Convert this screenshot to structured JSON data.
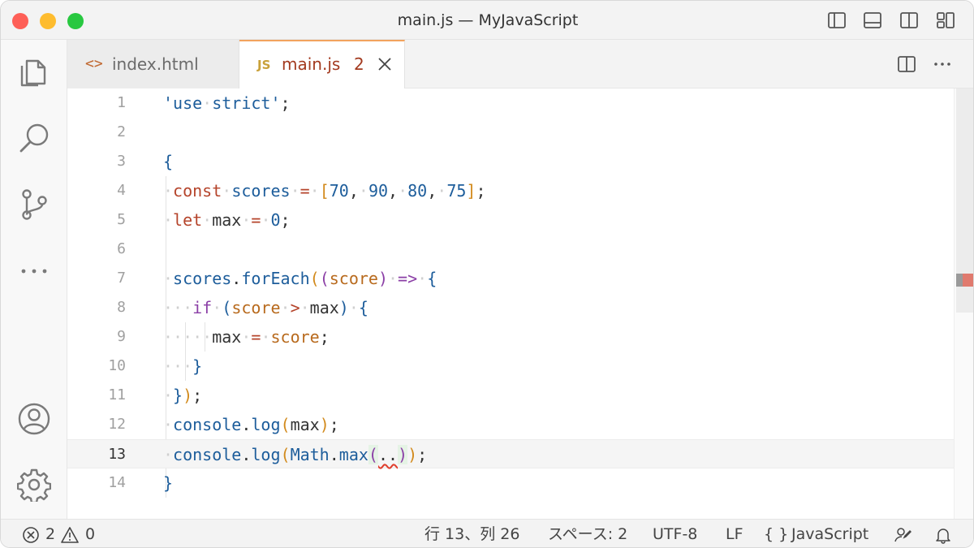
{
  "window": {
    "title": "main.js — MyJavaScript"
  },
  "tabs": [
    {
      "icon": "<>",
      "label": "index.html"
    },
    {
      "icon": "JS",
      "label": "main.js",
      "badge": "2"
    }
  ],
  "editor": {
    "line_numbers": [
      "1",
      "2",
      "3",
      "4",
      "5",
      "6",
      "7",
      "8",
      "9",
      "10",
      "11",
      "12",
      "13",
      "14"
    ],
    "current_line": 13
  },
  "status": {
    "errors": "2",
    "warnings": "0",
    "cursor": "行 13、列 26",
    "indent": "スペース: 2",
    "encoding": "UTF-8",
    "eol": "LF",
    "language_braces": "{ }",
    "language": "JavaScript"
  },
  "colors": {
    "keyword": "#b5442b",
    "identifier": "#1d5d9b",
    "bracket": "#d28a1c",
    "tab_accent": "#f2a35e"
  },
  "icons": {
    "activity": [
      "explorer-icon",
      "search-icon",
      "source-control-icon",
      "more-icon",
      "account-icon",
      "settings-gear-icon"
    ],
    "titlebar": [
      "toggle-primary-sidebar-icon",
      "toggle-panel-icon",
      "toggle-secondary-sidebar-icon",
      "customize-layout-icon"
    ],
    "editor_actions": [
      "split-editor-icon",
      "more-actions-icon"
    ],
    "statusbar": [
      "error-icon",
      "warning-icon",
      "feedback-icon",
      "notifications-bell-icon"
    ]
  }
}
